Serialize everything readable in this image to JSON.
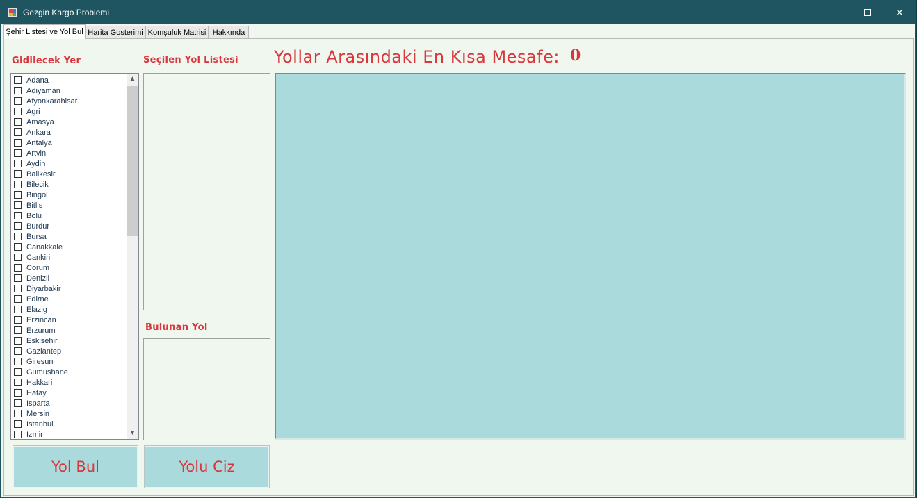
{
  "window": {
    "title": "Gezgin Kargo Problemi"
  },
  "tabs": [
    {
      "label": "Şehir Listesi ve Yol Bul",
      "active": true
    },
    {
      "label": "Harita Gosterimi",
      "active": false
    },
    {
      "label": "Komşuluk Matrisi",
      "active": false
    },
    {
      "label": "Hakkında",
      "active": false
    }
  ],
  "left_panel": {
    "title": "Gidilecek Yer",
    "cities": [
      "Adana",
      "Adiyaman",
      "Afyonkarahisar",
      "Agri",
      "Amasya",
      "Ankara",
      "Antalya",
      "Artvin",
      "Aydin",
      "Balikesir",
      "Bilecik",
      "Bingol",
      "Bitlis",
      "Bolu",
      "Burdur",
      "Bursa",
      "Canakkale",
      "Cankiri",
      "Corum",
      "Denizli",
      "Diyarbakir",
      "Edirne",
      "Elazig",
      "Erzincan",
      "Erzurum",
      "Eskisehir",
      "Gaziantep",
      "Giresun",
      "Gumushane",
      "Hakkari",
      "Hatay",
      "Isparta",
      "Mersin",
      "Istanbul",
      "Izmir"
    ]
  },
  "selected_panel": {
    "title": "Seçilen Yol Listesi"
  },
  "found_panel": {
    "title": "Bulunan Yol"
  },
  "distance": {
    "label": "Yollar Arasındaki En Kısa Mesafe:",
    "value": "0"
  },
  "buttons": {
    "find_label": "Yol Bul",
    "draw_label": "Yolu Ciz"
  },
  "colors": {
    "accent": "#d9363e",
    "titlebar": "#1e5560",
    "map_background": "#aadadb"
  }
}
